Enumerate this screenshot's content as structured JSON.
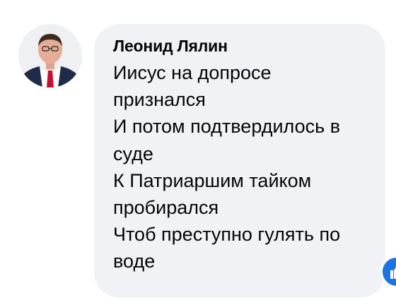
{
  "comment": {
    "author_name": "Леонид Лялин",
    "lines": [
      "Иисус на допросе",
      "признался",
      "И потом подтвердилось в",
      "суде",
      "К Патриаршим тайком",
      "пробирался",
      "Чтоб преступно гулять по",
      "воде"
    ],
    "reaction_icon": "like-icon",
    "colors": {
      "bubble": "#f0f2f5",
      "text": "#050505",
      "reaction": "#1b74e4"
    }
  }
}
